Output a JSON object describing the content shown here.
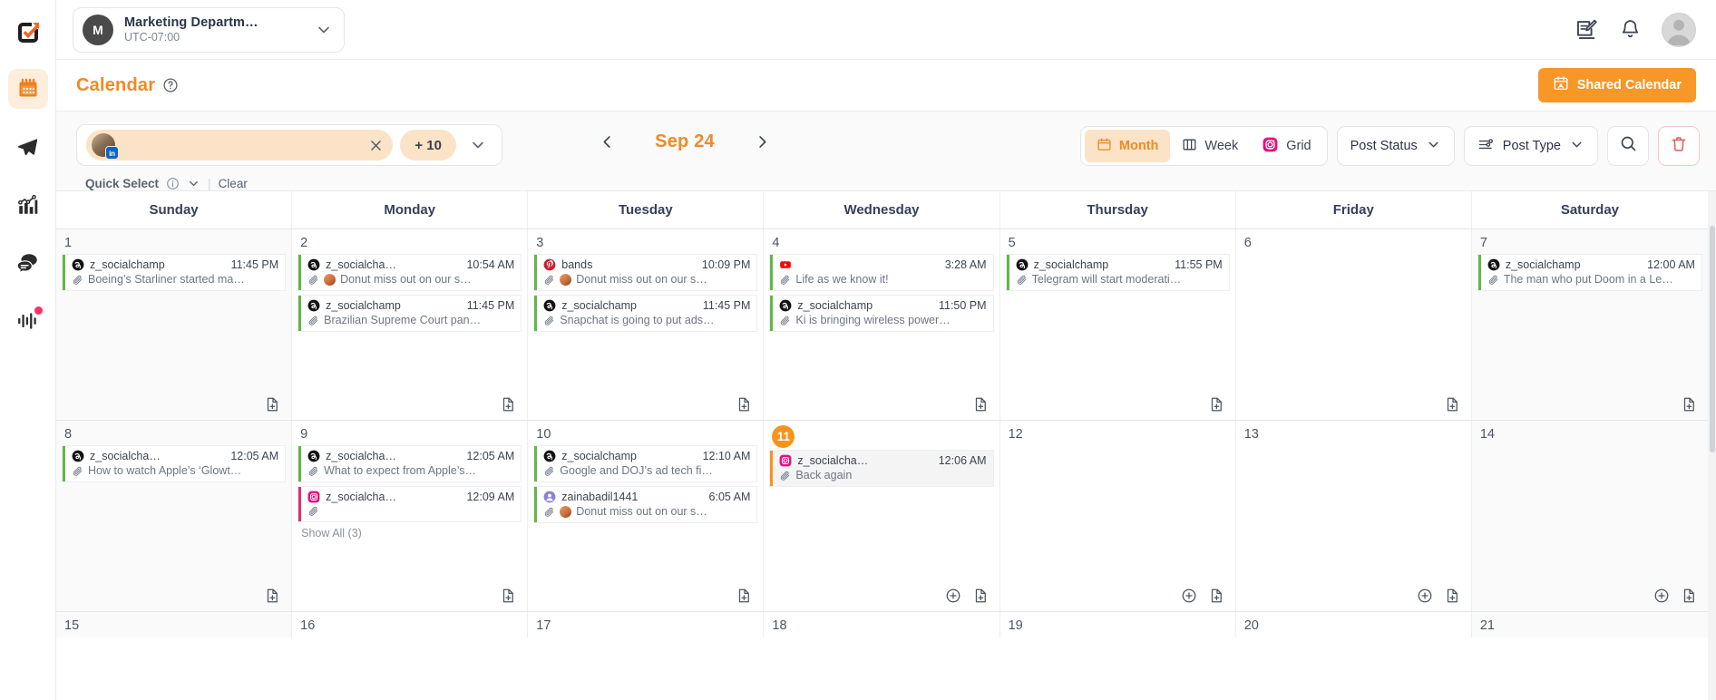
{
  "rail": {
    "logo_icon": "socialchamp-logo-icon",
    "items": [
      {
        "name": "calendar",
        "icon": "calendar-icon",
        "active": true,
        "badge": false
      },
      {
        "name": "publish",
        "icon": "paper-plane-icon",
        "active": false,
        "badge": false
      },
      {
        "name": "analytics",
        "icon": "bar-chart-icon",
        "active": false,
        "badge": false
      },
      {
        "name": "engage",
        "icon": "chat-bubbles-icon",
        "active": false,
        "badge": false
      },
      {
        "name": "monitor",
        "icon": "sound-wave-icon",
        "active": false,
        "badge": true
      }
    ]
  },
  "topbar": {
    "workspace": {
      "avatar_initial": "M",
      "name": "Marketing Departm…",
      "timezone": "UTC-07:00",
      "chevron_icon": "chevron-down-icon"
    },
    "compose_icon": "compose-note-icon",
    "notifications_icon": "bell-icon",
    "avatar_icon": "user-avatar-icon"
  },
  "page_header": {
    "title": "Calendar",
    "help_icon": "question-circle-icon",
    "shared_calendar": {
      "label": "Shared Calendar",
      "icon": "shared-calendar-icon",
      "color": "#f79728"
    }
  },
  "toolbar": {
    "account_filter": {
      "chip_avatar_icon": "account-avatar",
      "chip_network": "linkedin",
      "chip_network_label": "in",
      "clear_icon": "close-icon",
      "more_label": "+ 10",
      "expand_icon": "chevron-down-icon"
    },
    "quick_select": {
      "label": "Quick Select",
      "info_icon": "info-circle-icon",
      "chevron_icon": "chevron-down-icon",
      "divider": "|",
      "clear_label": "Clear"
    },
    "navigation": {
      "prev_icon": "chevron-left-icon",
      "date_label": "Sep 24",
      "next_icon": "chevron-right-icon"
    },
    "views": [
      {
        "label": "Month",
        "icon": "calendar-icon",
        "active": true
      },
      {
        "label": "Week",
        "icon": "columns-icon",
        "active": false
      },
      {
        "label": "Grid",
        "icon": "instagram-icon",
        "active": false
      }
    ],
    "post_status": {
      "label": "Post Status",
      "chevron_icon": "chevron-down-icon"
    },
    "post_type": {
      "label": "Post Type",
      "filter_icon": "sliders-icon",
      "chevron_icon": "chevron-down-icon"
    },
    "search_icon": "search-icon",
    "delete_icon": "trash-icon"
  },
  "calendar": {
    "day_names": [
      "Sunday",
      "Monday",
      "Tuesday",
      "Wednesday",
      "Thursday",
      "Friday",
      "Saturday"
    ],
    "add_post_icon": "add-document-icon",
    "add_icon": "plus-circle-icon",
    "attachment_icon": "paperclip-icon",
    "weeks": [
      {
        "days": [
          {
            "num": "1",
            "weekend": true,
            "today": false,
            "show_footer_add": false,
            "show_footer_doc": true,
            "events": [
              {
                "network": "threads",
                "user": "z_socialchamp",
                "time": "11:45 PM",
                "text": "Boeing’s Starliner started ma…",
                "avatar": false
              }
            ]
          },
          {
            "num": "2",
            "weekend": false,
            "today": false,
            "show_footer_add": false,
            "show_footer_doc": true,
            "events": [
              {
                "network": "threads",
                "user": "z_socialcha…",
                "time": "10:54 AM",
                "text": "Donut miss out on our s…",
                "avatar": true
              },
              {
                "network": "threads",
                "user": "z_socialchamp",
                "time": "11:45 PM",
                "text": "Brazilian Supreme Court pan…",
                "avatar": false
              }
            ]
          },
          {
            "num": "3",
            "weekend": false,
            "today": false,
            "show_footer_add": false,
            "show_footer_doc": true,
            "events": [
              {
                "network": "pinterest",
                "user": "bands",
                "time": "10:09 PM",
                "text": "Donut miss out on our s…",
                "avatar": true
              },
              {
                "network": "threads",
                "user": "z_socialchamp",
                "time": "11:45 PM",
                "text": "Snapchat is going to put ads…",
                "avatar": false
              }
            ]
          },
          {
            "num": "4",
            "weekend": false,
            "today": false,
            "show_footer_add": false,
            "show_footer_doc": true,
            "events": [
              {
                "network": "youtube",
                "user": "",
                "time": "3:28 AM",
                "text": "Life as we know it!",
                "avatar": false
              },
              {
                "network": "threads",
                "user": "z_socialchamp",
                "time": "11:50 PM",
                "text": "Ki is bringing wireless power…",
                "avatar": false
              }
            ]
          },
          {
            "num": "5",
            "weekend": false,
            "today": false,
            "show_footer_add": false,
            "show_footer_doc": true,
            "events": [
              {
                "network": "threads",
                "user": "z_socialchamp",
                "time": "11:55 PM",
                "text": "Telegram will start moderati…",
                "avatar": false
              }
            ]
          },
          {
            "num": "6",
            "weekend": false,
            "today": false,
            "show_footer_add": false,
            "show_footer_doc": true,
            "events": []
          },
          {
            "num": "7",
            "weekend": true,
            "today": false,
            "show_footer_add": false,
            "show_footer_doc": true,
            "events": [
              {
                "network": "threads",
                "user": "z_socialchamp",
                "time": "12:00 AM",
                "text": "The man who put Doom in a Le…",
                "avatar": false
              }
            ]
          }
        ]
      },
      {
        "days": [
          {
            "num": "8",
            "weekend": true,
            "today": false,
            "show_footer_add": false,
            "show_footer_doc": true,
            "events": [
              {
                "network": "threads",
                "user": "z_socialcha…",
                "time": "12:05 AM",
                "text": "How to watch Apple’s ‘Glowt…",
                "avatar": false
              }
            ]
          },
          {
            "num": "9",
            "weekend": false,
            "today": false,
            "show_footer_add": false,
            "show_footer_doc": true,
            "show_all": "Show All (3)",
            "events": [
              {
                "network": "threads",
                "user": "z_socialcha…",
                "time": "12:05 AM",
                "text": "What to expect from Apple’s…",
                "avatar": false
              },
              {
                "network": "instagram",
                "user": "z_socialcha…",
                "time": "12:09 AM",
                "text": "",
                "avatar": false,
                "accent": "#e1306c"
              }
            ]
          },
          {
            "num": "10",
            "weekend": false,
            "today": false,
            "show_footer_add": false,
            "show_footer_doc": true,
            "events": [
              {
                "network": "threads",
                "user": "z_socialchamp",
                "time": "12:10 AM",
                "text": "Google and DOJ’s ad tech fi…",
                "avatar": false
              },
              {
                "network": "other",
                "user": "zainabadil1441",
                "time": "6:05 AM",
                "text": "Donut miss out on our s…",
                "avatar": true
              }
            ]
          },
          {
            "num": "11",
            "weekend": false,
            "today": true,
            "show_footer_add": true,
            "show_footer_doc": true,
            "events": [
              {
                "network": "instagram",
                "user": "z_socialcha…",
                "time": "12:06 AM",
                "text": "Back again",
                "avatar": false,
                "today_event": true
              }
            ]
          },
          {
            "num": "12",
            "weekend": false,
            "today": false,
            "show_footer_add": true,
            "show_footer_doc": true,
            "events": []
          },
          {
            "num": "13",
            "weekend": false,
            "today": false,
            "show_footer_add": true,
            "show_footer_doc": true,
            "events": []
          },
          {
            "num": "14",
            "weekend": true,
            "today": false,
            "show_footer_add": true,
            "show_footer_doc": true,
            "events": []
          }
        ]
      },
      {
        "days": [
          {
            "num": "15",
            "weekend": true,
            "today": false,
            "show_footer_add": false,
            "show_footer_doc": false,
            "events": []
          },
          {
            "num": "16",
            "weekend": false,
            "today": false,
            "show_footer_add": false,
            "show_footer_doc": false,
            "events": []
          },
          {
            "num": "17",
            "weekend": false,
            "today": false,
            "show_footer_add": false,
            "show_footer_doc": false,
            "events": []
          },
          {
            "num": "18",
            "weekend": false,
            "today": false,
            "show_footer_add": false,
            "show_footer_doc": false,
            "events": []
          },
          {
            "num": "19",
            "weekend": false,
            "today": false,
            "show_footer_add": false,
            "show_footer_doc": false,
            "events": []
          },
          {
            "num": "20",
            "weekend": false,
            "today": false,
            "show_footer_add": false,
            "show_footer_doc": false,
            "events": []
          },
          {
            "num": "21",
            "weekend": true,
            "today": false,
            "show_footer_add": false,
            "show_footer_doc": false,
            "events": []
          }
        ]
      }
    ]
  },
  "colors": {
    "accent": "#f08a24",
    "brand_button": "#f79728",
    "event_green": "#63b649",
    "today": "#f7941e",
    "instagram": "#e1306c",
    "pinterest": "#d32b43",
    "linkedin": "#0a66c2"
  }
}
